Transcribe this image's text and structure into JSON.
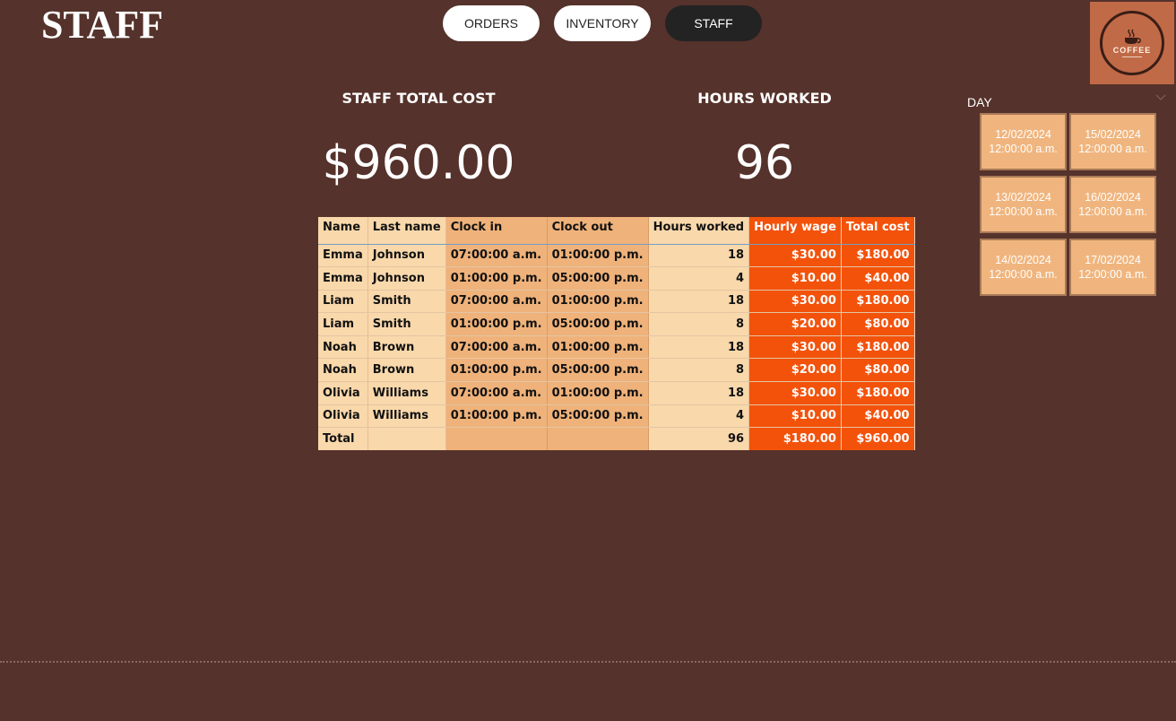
{
  "page": {
    "title": "STAFF"
  },
  "nav": {
    "buttons": [
      "ORDERS",
      "INVENTORY",
      "STAFF"
    ],
    "active": "STAFF"
  },
  "logo": {
    "text": "COFFEE"
  },
  "kpis": {
    "total_cost": {
      "label": "STAFF TOTAL COST",
      "value": "$960.00"
    },
    "hours_worked": {
      "label": "HOURS WORKED",
      "value": "96"
    }
  },
  "table": {
    "headers": [
      "Name",
      "Last name",
      "Clock in",
      "Clock out",
      "Hours worked",
      "Hourly wage",
      "Total cost"
    ],
    "rows": [
      [
        "Emma",
        "Johnson",
        "07:00:00 a.m.",
        "01:00:00 p.m.",
        "18",
        "$30.00",
        "$180.00"
      ],
      [
        "Emma",
        "Johnson",
        "01:00:00 p.m.",
        "05:00:00 p.m.",
        "4",
        "$10.00",
        "$40.00"
      ],
      [
        "Liam",
        "Smith",
        "07:00:00 a.m.",
        "01:00:00 p.m.",
        "18",
        "$30.00",
        "$180.00"
      ],
      [
        "Liam",
        "Smith",
        "01:00:00 p.m.",
        "05:00:00 p.m.",
        "8",
        "$20.00",
        "$80.00"
      ],
      [
        "Noah",
        "Brown",
        "07:00:00 a.m.",
        "01:00:00 p.m.",
        "18",
        "$30.00",
        "$180.00"
      ],
      [
        "Noah",
        "Brown",
        "01:00:00 p.m.",
        "05:00:00 p.m.",
        "8",
        "$20.00",
        "$80.00"
      ],
      [
        "Olivia",
        "Williams",
        "07:00:00 a.m.",
        "01:00:00 p.m.",
        "18",
        "$30.00",
        "$180.00"
      ],
      [
        "Olivia",
        "Williams",
        "01:00:00 p.m.",
        "05:00:00 p.m.",
        "4",
        "$10.00",
        "$40.00"
      ]
    ],
    "total": [
      "Total",
      "",
      "",
      "",
      "96",
      "$180.00",
      "$960.00"
    ]
  },
  "slicer": {
    "title": "DAY",
    "items": [
      {
        "date": "12/02/2024",
        "time": "12:00:00 a.m."
      },
      {
        "date": "15/02/2024",
        "time": "12:00:00 a.m."
      },
      {
        "date": "13/02/2024",
        "time": "12:00:00 a.m."
      },
      {
        "date": "16/02/2024",
        "time": "12:00:00 a.m."
      },
      {
        "date": "14/02/2024",
        "time": "12:00:00 a.m."
      },
      {
        "date": "17/02/2024",
        "time": "12:00:00 a.m."
      }
    ]
  },
  "colors": {
    "background": "#55322b",
    "accent_orange": "#f3520b",
    "cell_light": "#f9d8ab",
    "cell_mid": "#efb27a",
    "logo_bg": "#c06a47"
  },
  "icons": {
    "slicer_toggle": "chevron-down-icon",
    "logo": "coffee-cup-icon"
  }
}
